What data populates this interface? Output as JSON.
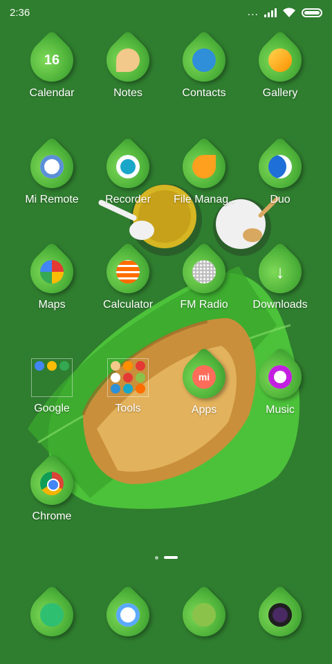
{
  "status": {
    "time": "2:36",
    "signal_dots": "..."
  },
  "apps": [
    {
      "label": "Calendar",
      "icon": "calendar-icon",
      "color": "#ffffff",
      "text": "16"
    },
    {
      "label": "Notes",
      "icon": "notes-icon",
      "color": "#f2c98a"
    },
    {
      "label": "Contacts",
      "icon": "contacts-icon",
      "color": "#2f8fd8"
    },
    {
      "label": "Gallery",
      "icon": "gallery-icon",
      "color": "#ff8f00"
    },
    {
      "label": "Mi Remote",
      "icon": "mi-remote-icon",
      "color": "#ffffff"
    },
    {
      "label": "Recorder",
      "icon": "recorder-icon",
      "color": "#19a7c9"
    },
    {
      "label": "File Manag..",
      "icon": "file-manager-icon",
      "color": "#ffa01e"
    },
    {
      "label": "Duo",
      "icon": "duo-icon",
      "color": "#1e6fd8"
    },
    {
      "label": "Maps",
      "icon": "maps-icon",
      "color": "#e53935"
    },
    {
      "label": "Calculator",
      "icon": "calculator-icon",
      "color": "#ff6d00"
    },
    {
      "label": "FM Radio",
      "icon": "fm-radio-icon",
      "color": "#cfcfcf"
    },
    {
      "label": "Downloads",
      "icon": "downloads-icon",
      "color": "#ffffff"
    },
    {
      "label": "Google",
      "icon": "google-folder-icon",
      "type": "folder"
    },
    {
      "label": "Tools",
      "icon": "tools-folder-icon",
      "type": "folder"
    },
    {
      "label": "Apps",
      "icon": "mi-apps-icon",
      "color": "#ff6d5a",
      "text": "mi"
    },
    {
      "label": "Music",
      "icon": "music-icon",
      "color": "#c31fe0"
    },
    {
      "label": "Chrome",
      "icon": "chrome-icon",
      "color": "#f4b400"
    }
  ],
  "dock": [
    {
      "icon": "phone-icon",
      "color": "#2fbf71"
    },
    {
      "icon": "messaging-icon",
      "color": "#5aa9ff"
    },
    {
      "icon": "browser-icon",
      "color": "#8bc34a"
    },
    {
      "icon": "camera-icon",
      "color": "#4a2a63"
    }
  ],
  "pager": {
    "current": 2,
    "total": 2
  }
}
